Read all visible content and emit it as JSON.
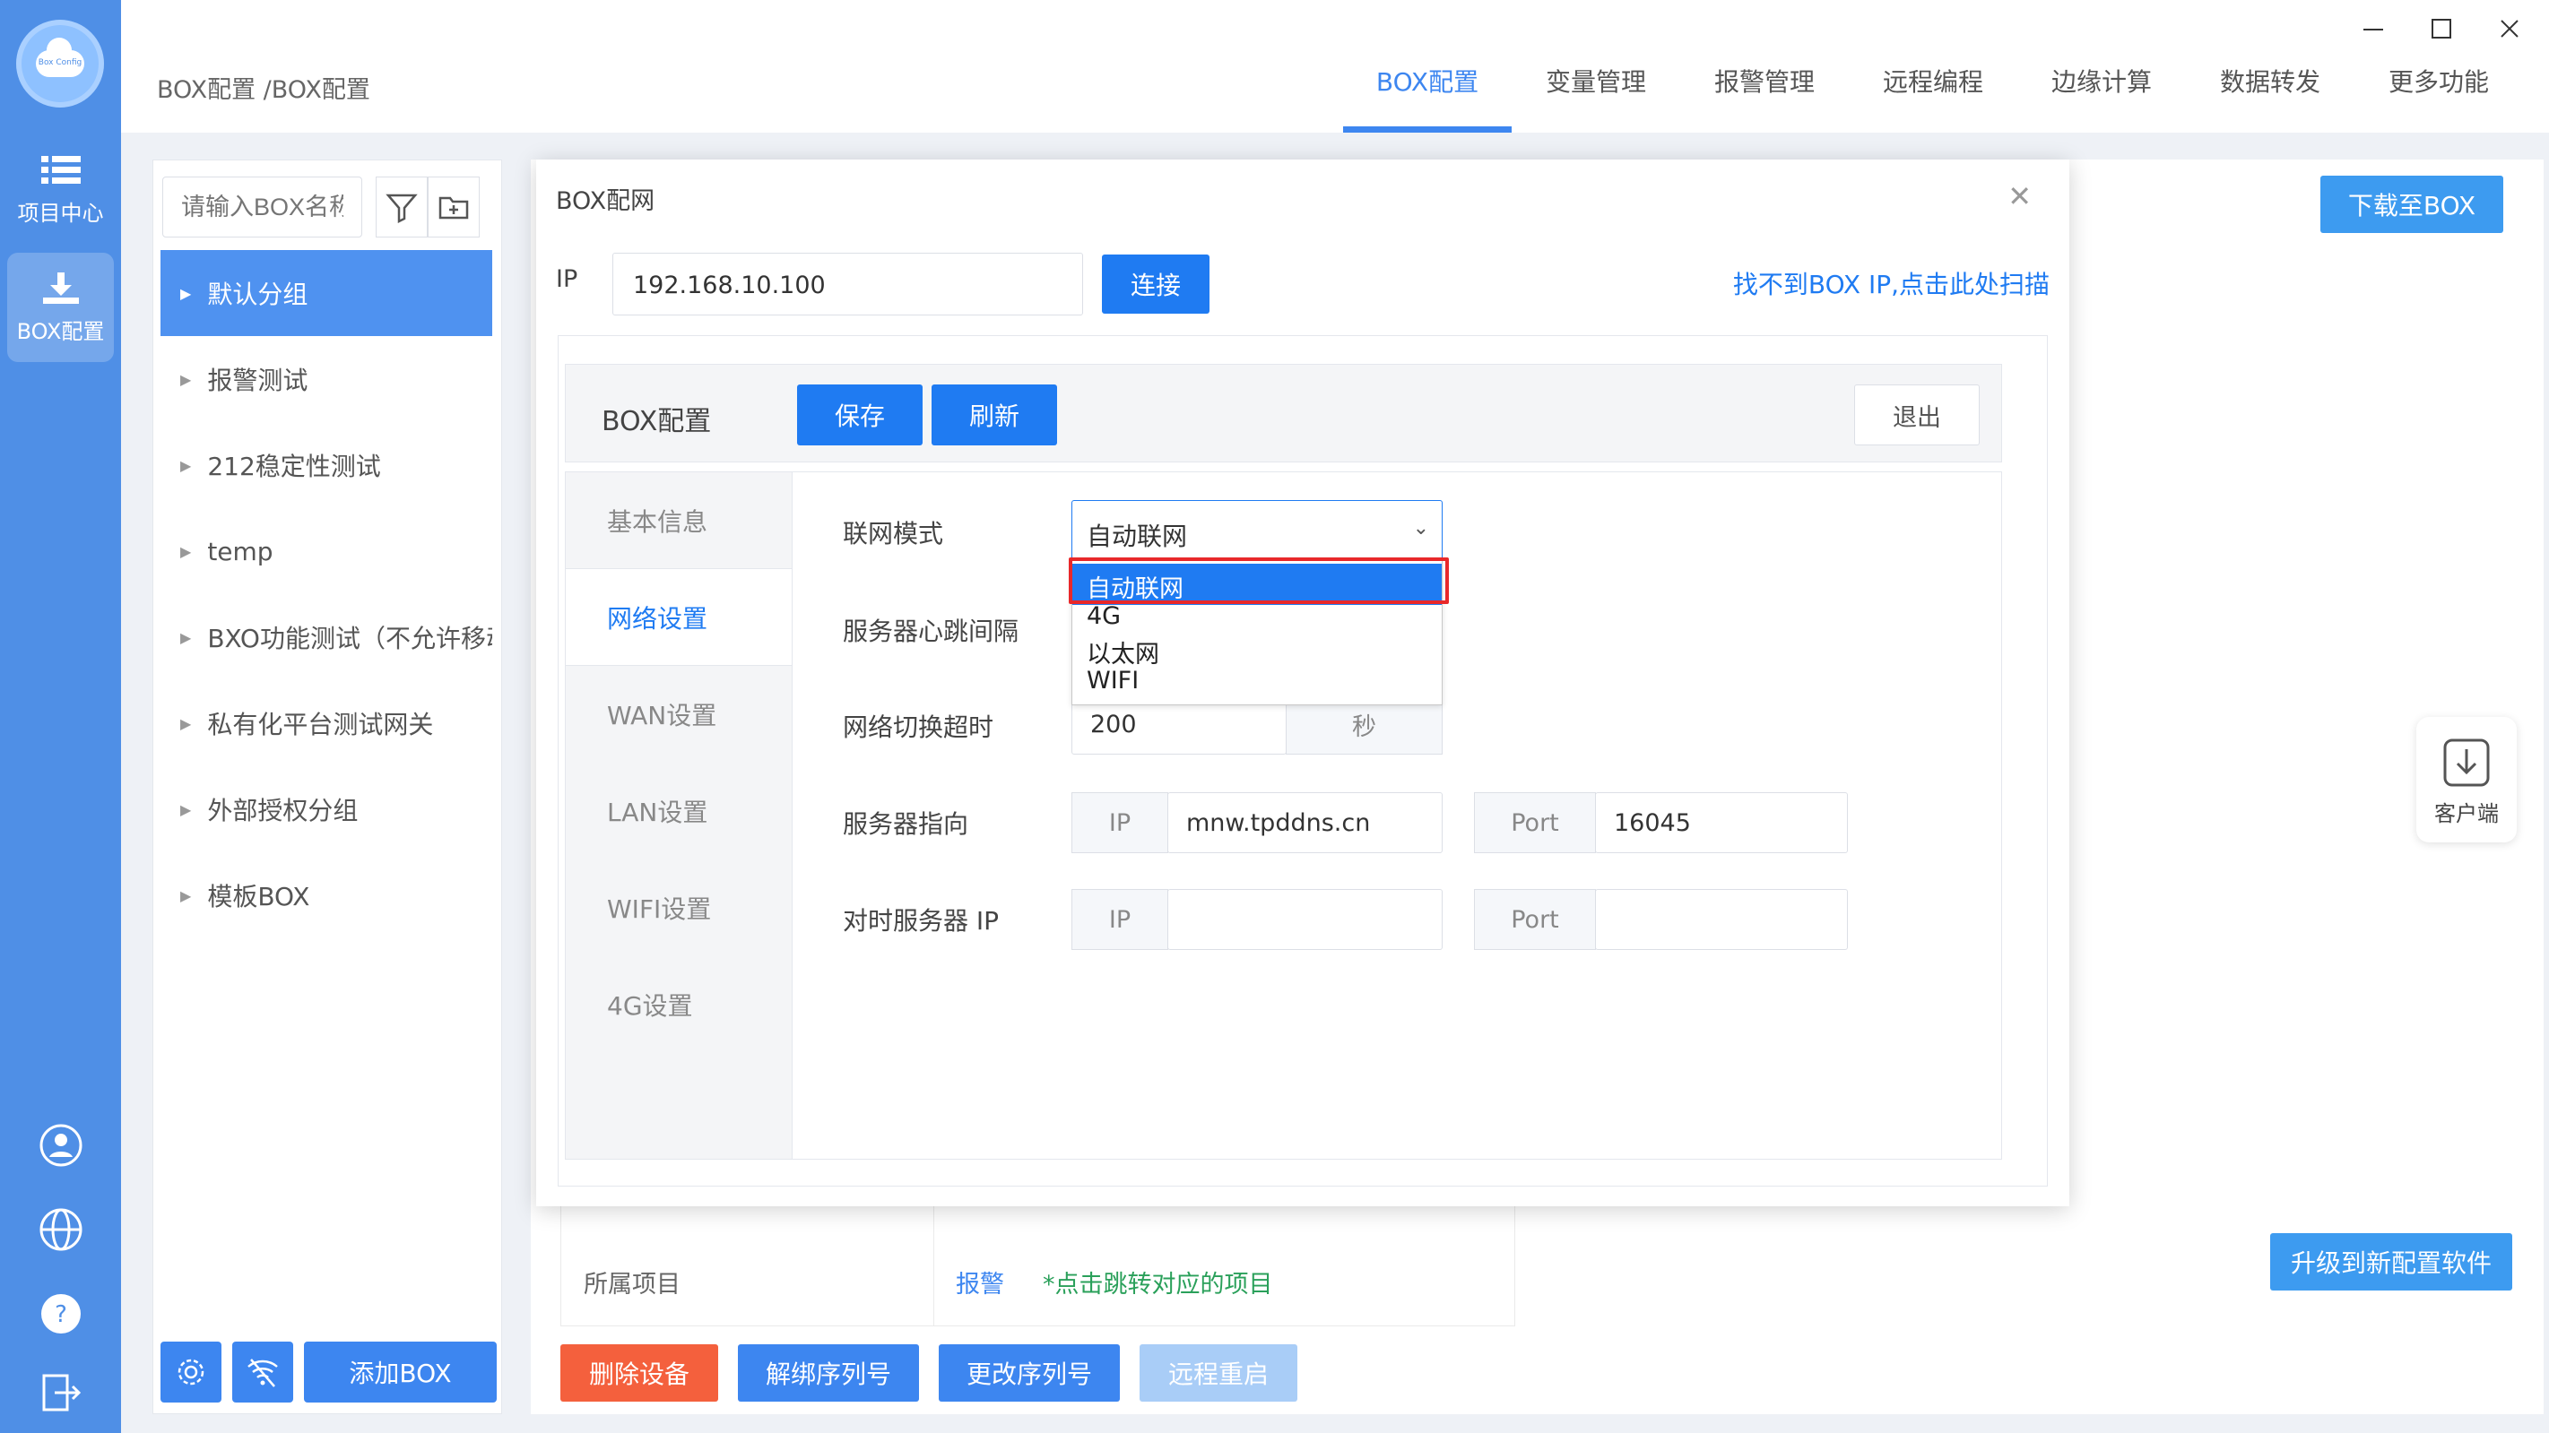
{
  "nav_rail": {
    "logo_text": "Box Config",
    "items": [
      {
        "label": "项目中心",
        "icon": "list-icon"
      },
      {
        "label": "BOX配置",
        "icon": "download-icon"
      }
    ],
    "bottom_icons": [
      "user-icon",
      "globe-icon",
      "help-icon",
      "exit-icon"
    ]
  },
  "header": {
    "breadcrumb": "BOX配置 /BOX配置",
    "tabs": [
      "BOX配置",
      "变量管理",
      "报警管理",
      "远程编程",
      "边缘计算",
      "数据转发",
      "更多功能"
    ],
    "active_tab": "BOX配置"
  },
  "sidebar": {
    "search_placeholder": "请输入BOX名称",
    "groups": [
      "默认分组",
      "报警测试",
      "212稳定性测试",
      "temp",
      "BXO功能测试（不允许移动）",
      "私有化平台测试网关",
      "外部授权分组",
      "模板BOX"
    ],
    "add_label": "添加BOX"
  },
  "main": {
    "download_label": "下载至BOX",
    "client_label": "客户端",
    "upgrade_label": "升级到新配置软件",
    "project_key": "所属项目",
    "project_link": "报警",
    "project_hint": "*点击跳转对应的项目",
    "actions": [
      "删除设备",
      "解绑序列号",
      "更改序列号",
      "远程重启"
    ]
  },
  "modal": {
    "title": "BOX配网",
    "ip_label": "IP",
    "ip_value": "192.168.10.100",
    "connect_label": "连接",
    "scan_link": "找不到BOX IP,点击此处扫描",
    "config_title": "BOX配置",
    "save_label": "保存",
    "refresh_label": "刷新",
    "exit_label": "退出",
    "tabs": [
      "基本信息",
      "网络设置",
      "WAN设置",
      "LAN设置",
      "WIFI设置",
      "4G设置"
    ],
    "active_tab": "网络设置",
    "form": {
      "mode_label": "联网模式",
      "mode_value": "自动联网",
      "mode_options": [
        "自动联网",
        "4G",
        "以太网",
        "WIFI"
      ],
      "heartbeat_label": "服务器心跳间隔",
      "switch_timeout_label": "网络切换超时",
      "switch_timeout_value": "200",
      "switch_timeout_unit": "秒",
      "server_label": "服务器指向",
      "server_ip_addon": "IP",
      "server_ip_value": "mnw.tpddns.cn",
      "server_port_addon": "Port",
      "server_port_value": "16045",
      "time_server_label": "对时服务器 IP",
      "time_ip_addon": "IP",
      "time_ip_value": "",
      "time_port_addon": "Port",
      "time_port_value": ""
    }
  },
  "colors": {
    "primary": "#1f7bf2",
    "rail": "#4f8fe6",
    "danger": "#f4603d",
    "highlight_box": "#e8282a"
  }
}
